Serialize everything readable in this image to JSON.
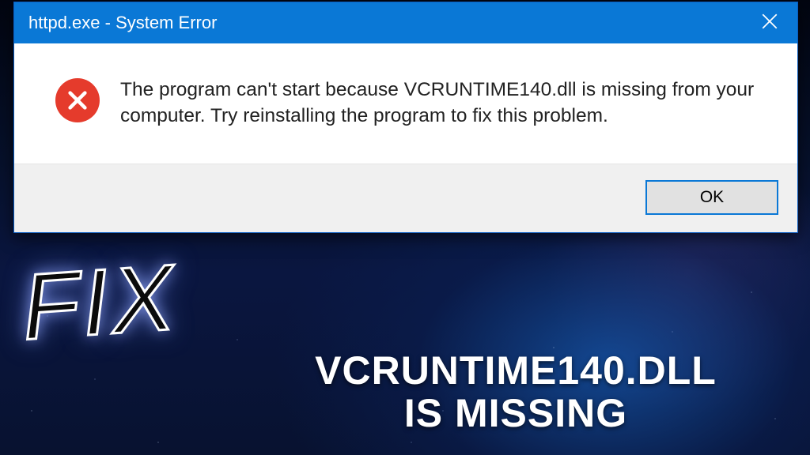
{
  "dialog": {
    "title": "httpd.exe - System Error",
    "message": "The program can't start because VCRUNTIME140.dll is missing from your computer. Try reinstalling the program to fix this problem.",
    "ok_label": "OK",
    "icon": "error-icon",
    "colors": {
      "titlebar": "#0a78d6",
      "error_red": "#e53b2c",
      "button_border": "#0a78d6"
    }
  },
  "overlay": {
    "fix_text": "FIX",
    "caption_line1": "VCRUNTIME140.DLL",
    "caption_line2": "IS MISSING"
  }
}
